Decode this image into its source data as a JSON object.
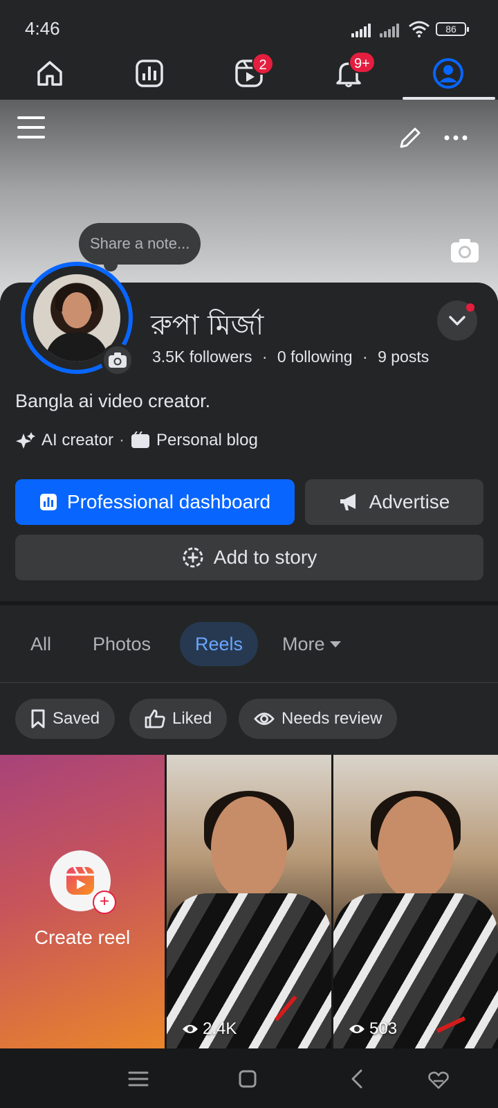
{
  "status_bar": {
    "time": "4:46",
    "battery": "86"
  },
  "top_nav": {
    "items": [
      "home-icon",
      "dashboard-icon",
      "reels-icon",
      "notifications-icon",
      "profile-icon"
    ],
    "reels_badge": "2",
    "notifications_badge": "9+"
  },
  "profile": {
    "note_placeholder": "Share a note...",
    "name": "রুপা মির্জা",
    "followers": "3.5K followers",
    "following": "0 following",
    "posts": "9 posts",
    "separator": "·",
    "bio": "Bangla ai video creator.",
    "category_1": "AI creator",
    "category_2": "Personal blog"
  },
  "actions": {
    "professional_dashboard": "Professional dashboard",
    "advertise": "Advertise",
    "add_to_story": "Add to story"
  },
  "tabs": {
    "all": "All",
    "photos": "Photos",
    "reels": "Reels",
    "more": "More",
    "active": "Reels"
  },
  "filters": {
    "saved": "Saved",
    "liked": "Liked",
    "needs_review": "Needs review"
  },
  "reels": {
    "create_label": "Create reel",
    "items": [
      {
        "views": "2.4K"
      },
      {
        "views": "503"
      }
    ]
  },
  "colors": {
    "accent": "#0866ff",
    "badge": "#e41e3f",
    "background": "#242526",
    "surface": "#3a3b3c"
  }
}
